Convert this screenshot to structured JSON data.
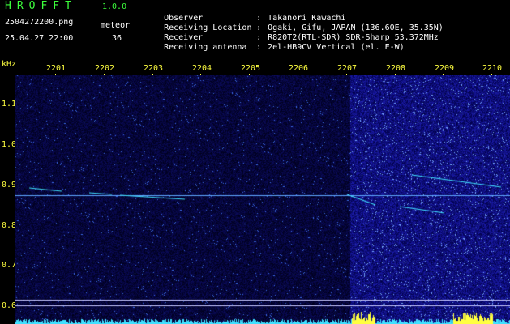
{
  "header": {
    "app_title": "HROFFT",
    "version": "1.0.0",
    "file_name": "2504272200.png",
    "date_time": "25.04.27 22:00",
    "mode_label": "meteor",
    "count_value": "36"
  },
  "station_info": [
    {
      "label": "Observer",
      "value": "Takanori Kawachi"
    },
    {
      "label": "Receiving Location",
      "value": "Ogaki, Gifu, JAPAN (136.60E, 35.35N)"
    },
    {
      "label": "Receiver",
      "value": "R820T2(RTL-SDR) SDR-Sharp 53.372MHz"
    },
    {
      "label": "Receiving antenna",
      "value": "2el-HB9CV Vertical (el. E-W)"
    }
  ],
  "axis": {
    "unit": "kHz",
    "y_ticks": [
      "1.1",
      "1.0",
      "0.9",
      "0.8",
      "0.7",
      "0.6"
    ],
    "x_ticks": [
      "2201",
      "2202",
      "2203",
      "2204",
      "2205",
      "2206",
      "2207",
      "2208",
      "2209",
      "2210"
    ]
  },
  "colors": {
    "background": "#000000",
    "spectrum_dark": "#000030",
    "spectrum_bright": "#10108a",
    "label_green": "#3cff3c",
    "label_yellow": "#ffff40",
    "trace_cyan": "#40e0ff"
  }
}
